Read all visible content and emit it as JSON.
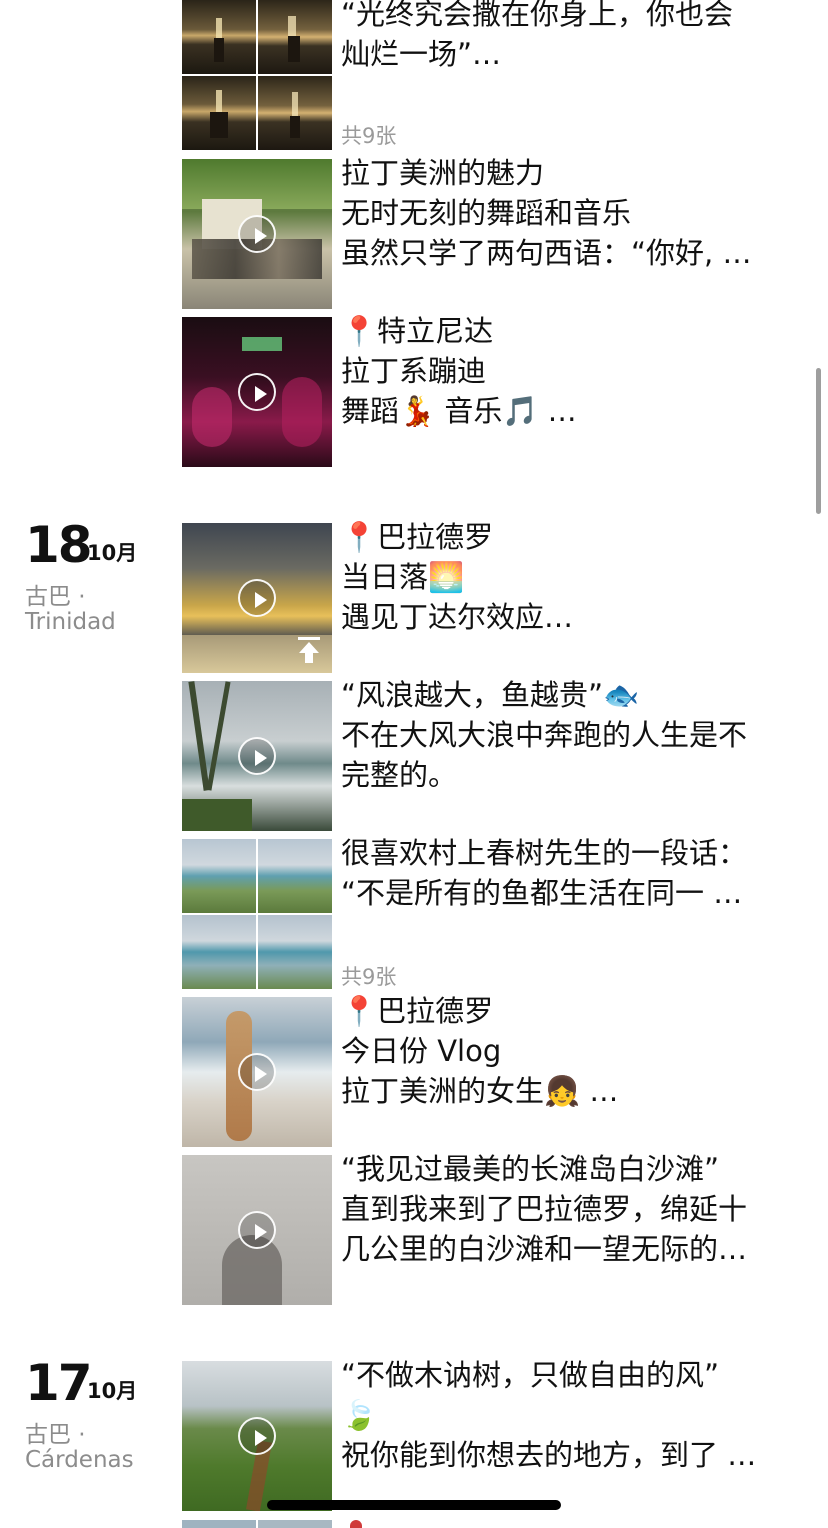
{
  "posts": [
    {
      "lines": [
        "“光终究会撒在你身上，你也会",
        "灿烂一场”…"
      ],
      "count": "共9张"
    },
    {
      "lines": [
        "拉丁美洲的魅力",
        "无时无刻的舞蹈和音乐",
        "虽然只学了两句西语：“你好, …"
      ]
    },
    {
      "lines": [
        "📍特立尼达",
        "拉丁系蹦迪",
        "舞蹈💃 音乐🎵 …"
      ]
    },
    {
      "lines": [
        "📍巴拉德罗",
        "当日落🌅",
        "遇见丁达尔效应…"
      ]
    },
    {
      "lines": [
        "“风浪越大，鱼越贵”🐟",
        "不在大风大浪中奔跑的人生是不",
        "完整的。"
      ]
    },
    {
      "lines": [
        "很喜欢村上春树先生的一段话：",
        "“不是所有的鱼都生活在同一 …"
      ],
      "count": "共9张"
    },
    {
      "lines": [
        "📍巴拉德罗",
        "今日份 Vlog",
        "拉丁美洲的女生👧 …"
      ]
    },
    {
      "lines": [
        "“我见过最美的长滩岛白沙滩”",
        "直到我来到了巴拉德罗，绵延十",
        "几公里的白沙滩和一望无际的…"
      ]
    },
    {
      "lines": [
        "“不做木讷树，只做自由的风”",
        "🍃",
        "祝你能到你想去的地方，到了 …"
      ]
    }
  ],
  "dates": [
    {
      "day": "18",
      "month": "10月",
      "country": "古巴 ·",
      "city": "Trinidad"
    },
    {
      "day": "17",
      "month": "10月",
      "country": "古巴 ·",
      "city": "Cárdenas"
    }
  ],
  "icons": {
    "play": "play-icon",
    "upload": "upload-icon",
    "pin": "pin-icon"
  },
  "colors": {
    "text": "#111111",
    "meta": "#8c8c8c",
    "count": "#9a9a9a",
    "background": "#ffffff"
  }
}
